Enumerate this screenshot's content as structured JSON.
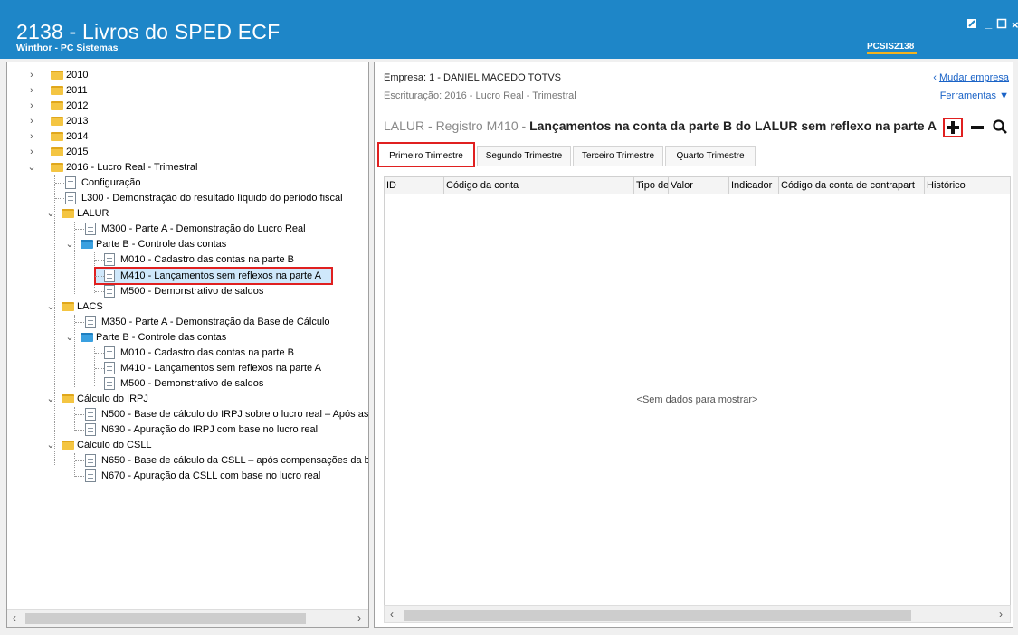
{
  "window": {
    "title": "2138 - Livros do SPED ECF",
    "subtitle": "Winthor - PC Sistemas",
    "code": "PCSIS2138"
  },
  "tree": {
    "years": [
      "2010",
      "2011",
      "2012",
      "2013",
      "2014",
      "2015"
    ],
    "root_2016": "2016 - Lucro Real - Trimestral",
    "configuracao": "Configuração",
    "l300": "L300 - Demonstração do resultado líquido do período fiscal",
    "lalur": "LALUR",
    "lalur_m300": "M300 - Parte A - Demonstração do Lucro Real",
    "lalur_parteb": "Parte B - Controle das contas",
    "lalur_m010": "M010 - Cadastro das contas na parte B",
    "lalur_m410": "M410 - Lançamentos sem reflexos na parte A",
    "lalur_m500": "M500 - Demonstrativo de saldos",
    "lacs": "LACS",
    "lacs_m350": "M350 - Parte A - Demonstração da Base de Cálculo",
    "lacs_parteb": "Parte B - Controle das contas",
    "lacs_m010": "M010 - Cadastro das contas na parte B",
    "lacs_m410": "M410 - Lançamentos sem reflexos na parte A",
    "lacs_m500": "M500 - Demonstrativo de saldos",
    "irpj": "Cálculo do IRPJ",
    "irpj_n500": "N500 - Base de cálculo do IRPJ sobre o lucro real – Após as",
    "irpj_n630": "N630 - Apuração do IRPJ com base no lucro real",
    "csll": "Cálculo do CSLL",
    "csll_n650": "N650 - Base de cálculo da CSLL – após compensações da b",
    "csll_n670": "N670 - Apuração da CSLL com base no lucro real"
  },
  "main": {
    "empresa": "Empresa: 1 - DANIEL MACEDO TOTVS",
    "escrituracao": "Escrituração: 2016 - Lucro Real - Trimestral",
    "mudar_empresa": "Mudar empresa",
    "ferramentas": "Ferramentas",
    "registro_prefix": "LALUR - Registro M410 -",
    "registro_desc": "Lançamentos na conta da parte B do LALUR sem reflexo na parte A",
    "tabs": [
      "Primeiro Trimestre",
      "Segundo Trimestre",
      "Terceiro Trimestre",
      "Quarto Trimestre"
    ],
    "columns": [
      "ID",
      "Código da conta",
      "Tipo de tr",
      "Valor",
      "Indicador",
      "Código da conta de contrapart",
      "Histórico"
    ],
    "empty_message": "<Sem dados para mostrar>"
  },
  "icons": {
    "add": "plus-icon",
    "remove": "minus-icon",
    "search": "search-icon",
    "folder_color": "#f4c542",
    "folder_blue_color": "#3aa0e0"
  },
  "colors": {
    "titlebar": "#1e86c8",
    "highlight": "#e02020",
    "link": "#1a63c7"
  }
}
